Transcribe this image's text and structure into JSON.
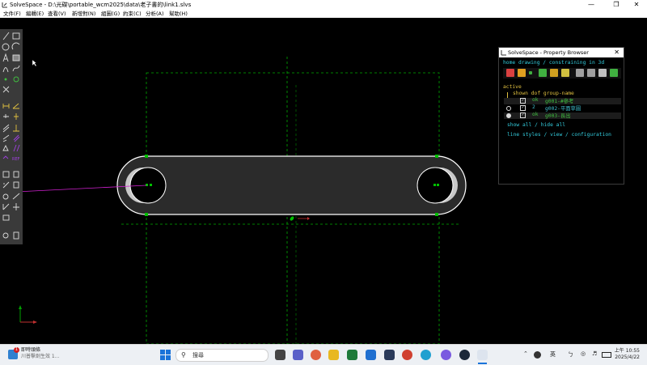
{
  "window": {
    "title": "SolveSpace - D:\\光碟\\portable_wcm2025\\data\\老子書的\\link1.slvs",
    "minimize": "—",
    "maximize": "❐",
    "close": "✕"
  },
  "menu": [
    "文件(F)",
    "編輯(E)",
    "查看(V)",
    "新增對(N)",
    "組圖(G)",
    "約束(C)",
    "分析(A)",
    "幫助(H)"
  ],
  "toolbar_icons": [
    "line-icon",
    "rectangle-icon",
    "circle-icon",
    "arc-icon",
    "datum-point-icon",
    "image-icon",
    "curve-icon",
    "spline-icon",
    "point-icon",
    "nearest-icon",
    "split-icon",
    "dimension-icon",
    "angle-icon",
    "horizontal-icon",
    "vertical-icon",
    "parallel-icon",
    "perpendicular-icon",
    "equal-icon",
    "ref-icon",
    "workplane-icon",
    "extrude-icon",
    "lathe-icon",
    "step-icon",
    "sketch-icon",
    "assembly-icon"
  ],
  "property_browser": {
    "title": "SolveSpace - Property Browser",
    "close": "✕",
    "nav": "home   drawing / constraining in 3d",
    "active_label": "active",
    "header": "shown dof group-name",
    "groups": [
      {
        "active": false,
        "shown": true,
        "dof": "ok",
        "name": "g001-#參考"
      },
      {
        "active": false,
        "shown": true,
        "dof": "2",
        "name": "g002-平面草圖"
      },
      {
        "active": true,
        "shown": true,
        "dof": "ok",
        "name": "g003-長出"
      }
    ],
    "links1": "show all / hide all",
    "links2": "line styles / view / configuration",
    "icon_colors": [
      "#d94040",
      "#e0a020",
      "#40b040",
      "#40b040",
      "#d0a020",
      "#a0a0a0",
      "#a0a0a0",
      "#c0c0c0",
      "#d0d0d0",
      "#40b040"
    ]
  },
  "taskbar": {
    "news_title": "即時頭條",
    "news_sub": "川普擊劍生效 1...",
    "news_badge": "1",
    "search_placeholder": "搜尋",
    "lang": "英",
    "ime": "ㄅ",
    "time": "上午 10:55",
    "date": "2025/4/22"
  },
  "colors": {
    "canvas": "#000000",
    "part_fill": "#2b2b2b",
    "edge": "#ffffff",
    "points": "#00c000",
    "construction": "#00aa00",
    "accent": "#33ccdd"
  }
}
